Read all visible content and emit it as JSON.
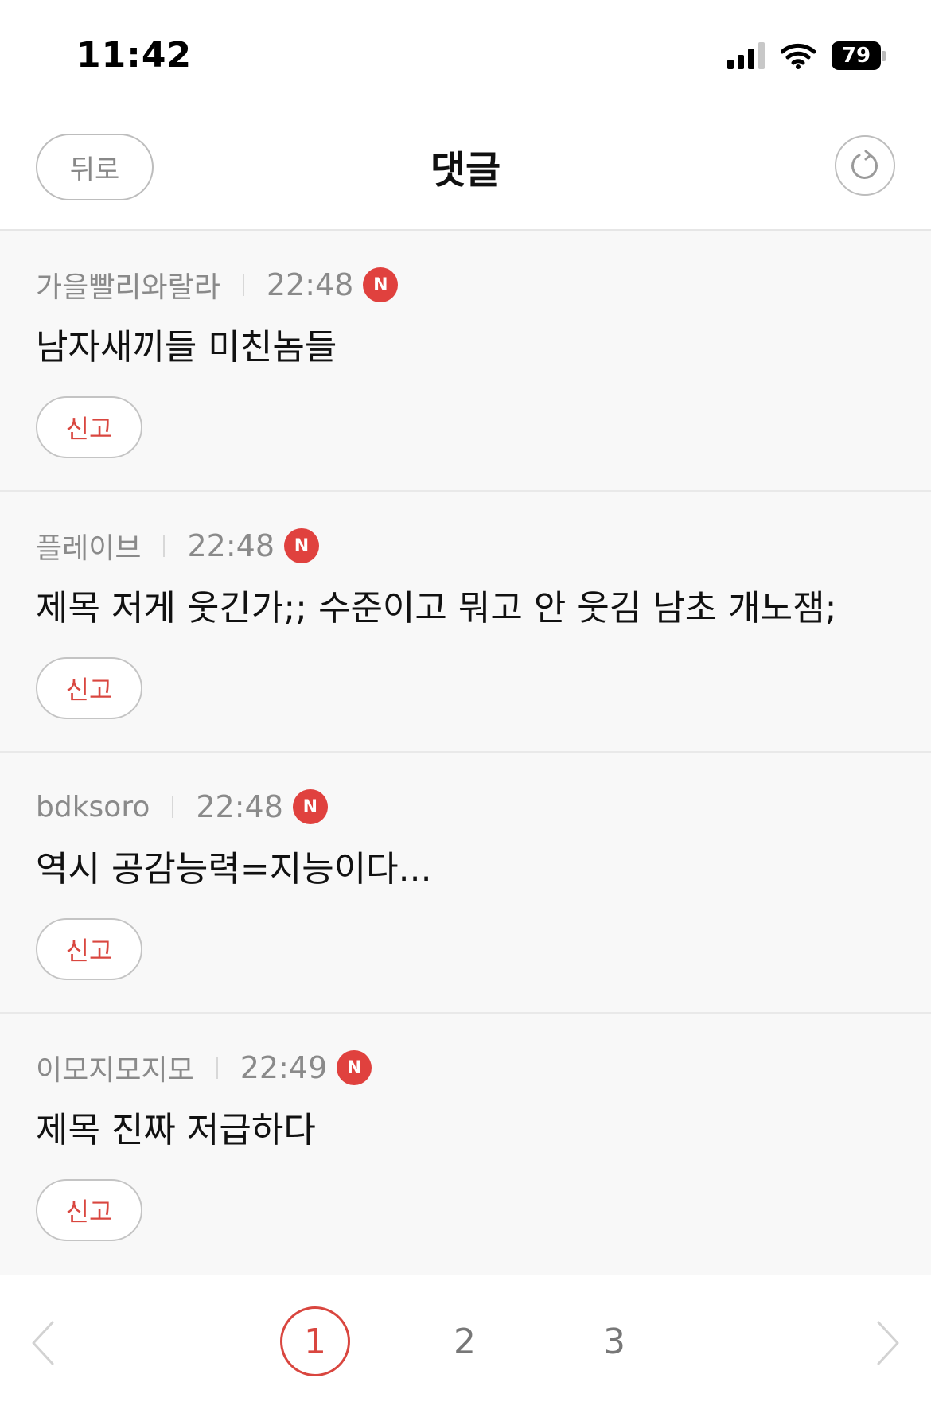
{
  "status_bar": {
    "time": "11:42",
    "battery": "79"
  },
  "header": {
    "back_label": "뒤로",
    "title": "댓글"
  },
  "comments": [
    {
      "author": "가을빨리와랄라",
      "time": "22:48",
      "badge": "N",
      "text": "남자새끼들 미친놈들",
      "report_label": "신고"
    },
    {
      "author": "플레이브",
      "time": "22:48",
      "badge": "N",
      "text": "제목 저게 웃긴가;; 수준이고 뭐고 안 웃김 남초 개노잼;",
      "report_label": "신고"
    },
    {
      "author": "bdksoro",
      "time": "22:48",
      "badge": "N",
      "text": "역시 공감능력=지능이다...",
      "report_label": "신고"
    },
    {
      "author": "이모지모지모",
      "time": "22:49",
      "badge": "N",
      "text": "제목 진짜 저급하다",
      "report_label": "신고"
    }
  ],
  "pagination": {
    "pages": [
      "1",
      "2",
      "3"
    ],
    "current": "1"
  },
  "colors": {
    "accent": "#e0413e",
    "muted": "#8a8a8a",
    "list_bg": "#f8f8f8"
  }
}
